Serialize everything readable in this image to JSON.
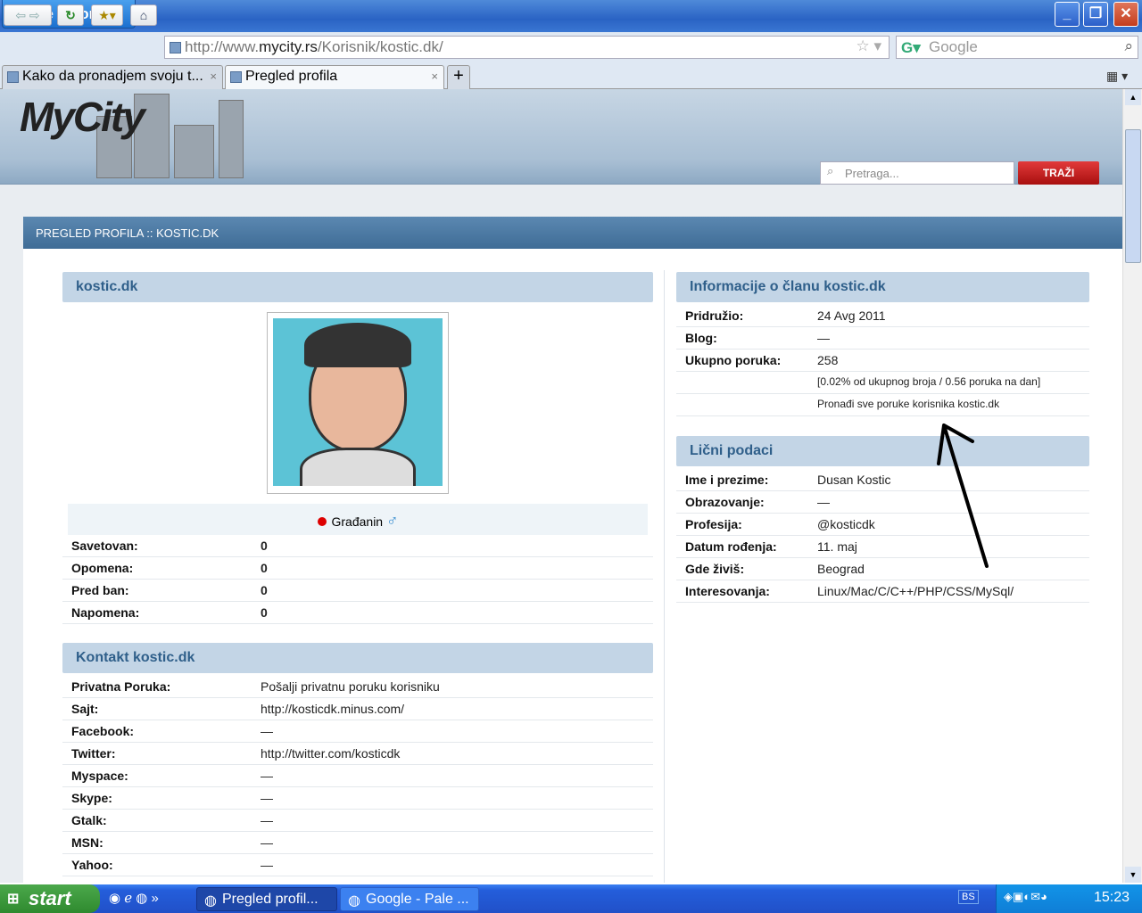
{
  "browser": {
    "app_name": "Pale Moon",
    "url_prefix": "http://www.",
    "url_domain": "mycity.rs",
    "url_path": "/Korisnik/kostic.dk/",
    "search_placeholder": "Google",
    "tabs": [
      {
        "label": "Kako da pronadjem svoju t..."
      },
      {
        "label": "Pregled profila"
      }
    ]
  },
  "site": {
    "logo": "MyCity",
    "search_placeholder": "Pretraga...",
    "search_button": "TRAŽI",
    "breadcrumb": "PREGLED PROFILA :: KOSTIC.DK"
  },
  "profile": {
    "title": "kostic.dk",
    "rank": "Građanin",
    "stats": [
      {
        "k": "Savetovan:",
        "v": "0"
      },
      {
        "k": "Opomena:",
        "v": "0"
      },
      {
        "k": "Pred ban:",
        "v": "0"
      },
      {
        "k": "Napomena:",
        "v": "0"
      }
    ]
  },
  "contact": {
    "title": "Kontakt kostic.dk",
    "rows": [
      {
        "k": "Privatna Poruka:",
        "v": "Pošalji privatnu poruku korisniku",
        "link": true
      },
      {
        "k": "Sajt:",
        "v": "http://kosticdk.minus.com/",
        "link": true
      },
      {
        "k": "Facebook:",
        "v": "—"
      },
      {
        "k": "Twitter:",
        "v": "http://twitter.com/kosticdk",
        "link": true
      },
      {
        "k": "Myspace:",
        "v": "—"
      },
      {
        "k": "Skype:",
        "v": "—"
      },
      {
        "k": "Gtalk:",
        "v": "—"
      },
      {
        "k": "MSN:",
        "v": "—"
      },
      {
        "k": "Yahoo:",
        "v": "—"
      }
    ]
  },
  "info": {
    "title": "Informacije o članu kostic.dk",
    "rows": [
      {
        "k": "Pridružio:",
        "v": "24 Avg 2011"
      },
      {
        "k": "Blog:",
        "v": "—"
      },
      {
        "k": "Ukupno poruka:",
        "v": "258"
      },
      {
        "k": "",
        "v": "[0.02% od ukupnog broja / 0.56 poruka na dan]"
      },
      {
        "k": "",
        "v": "Pronađi sve poruke korisnika kostic.dk",
        "link": true
      }
    ]
  },
  "personal": {
    "title": "Lični podaci",
    "rows": [
      {
        "k": "Ime i prezime:",
        "v": "Dusan Kostic"
      },
      {
        "k": "Obrazovanje:",
        "v": "—"
      },
      {
        "k": "Profesija:",
        "v": "@kosticdk"
      },
      {
        "k": "Datum rođenja:",
        "v": "11. maj"
      },
      {
        "k": "Gde živiš:",
        "v": "Beograd"
      },
      {
        "k": "Interesovanja:",
        "v": "Linux/Mac/C/C++/PHP/CSS/MySql/"
      }
    ]
  },
  "taskbar": {
    "start": "start",
    "tasks": [
      {
        "label": "Pregled profil..."
      },
      {
        "label": "Google - Pale ..."
      }
    ],
    "lang": "BS",
    "clock": "15:23"
  }
}
